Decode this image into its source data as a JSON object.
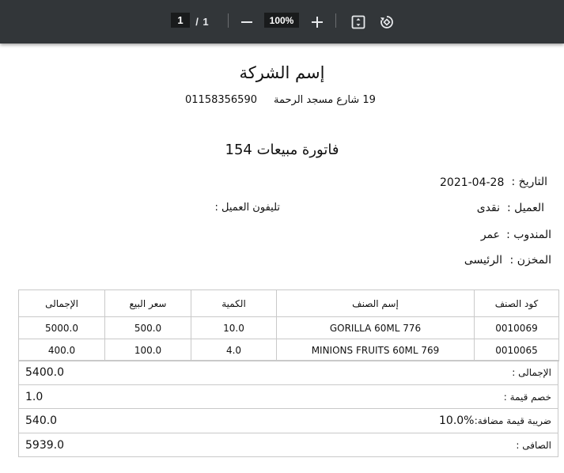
{
  "viewer": {
    "current_page": "1",
    "page_separator": "/",
    "total_pages": "1",
    "zoom": "100%",
    "icons": [
      "zoom-out-icon",
      "zoom-in-icon",
      "fit-page-icon",
      "rotate-icon"
    ]
  },
  "invoice": {
    "company_name": "إسم الشركة",
    "address": "19 شارع مسجد الرحمة",
    "phone": "01158356590",
    "title": "فاتورة مبيعات 154",
    "date_label": "التاريخ :",
    "date_value": "2021-04-28",
    "customer_label": "العميل :",
    "customer_value": "نقدى",
    "customer_phone_label": "تليفون العميل :",
    "rep_label": "المندوب :",
    "rep_value": "عمر",
    "store_label": "المخزن :",
    "store_value": "الرئيسى",
    "columns": {
      "code": "كود الصنف",
      "name": "إسم الصنف",
      "qty": "الكمية",
      "price": "سعر البيع",
      "total": "الإجمالى"
    },
    "items": [
      {
        "code": "0010069",
        "name": "GORILLA 60ML 776",
        "qty": "10.0",
        "price": "500.0",
        "total": "5000.0"
      },
      {
        "code": "0010065",
        "name": "MINIONS FRUITS 60ML 769",
        "qty": "4.0",
        "price": "100.0",
        "total": "400.0"
      }
    ],
    "totals": {
      "total_label": "الإجمالى :",
      "total_value": "5400.0",
      "discount_label": "خصم قيمة :",
      "discount_value": "1.0",
      "vat_label": "ضريبة قيمة مضافة:",
      "vat_percent": "10.0%",
      "vat_value": "540.0",
      "net_label": "الصافى :",
      "net_value": "5939.0"
    }
  }
}
